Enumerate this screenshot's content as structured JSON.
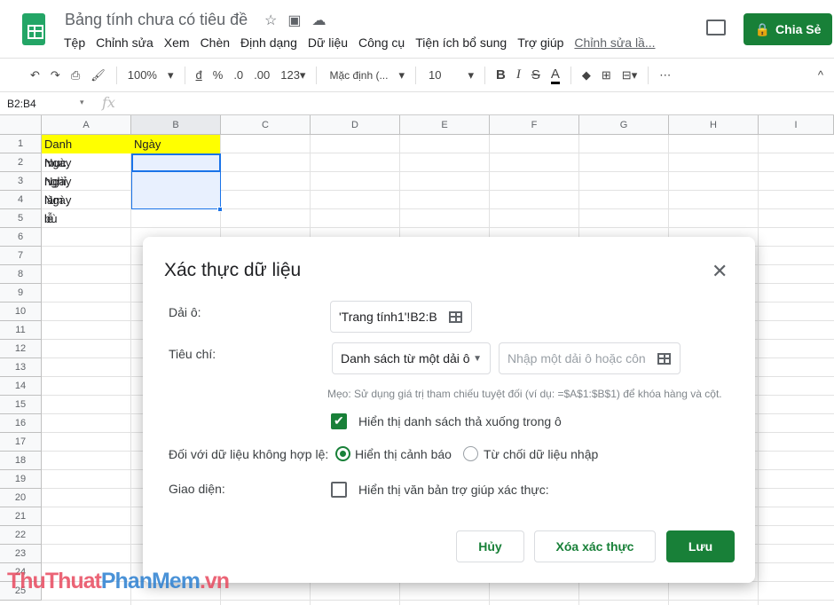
{
  "app": {
    "title": "Bảng tính chưa có tiêu đề",
    "share_label": "Chia Sẻ",
    "brand_color": "#188038",
    "menu": [
      "Tệp",
      "Chỉnh sửa",
      "Xem",
      "Chèn",
      "Định dạng",
      "Dữ liệu",
      "Công cụ",
      "Tiện ích bổ sung",
      "Trợ giúp"
    ],
    "last_edit": "Chỉnh sửa lầ..."
  },
  "toolbar": {
    "zoom": "100%",
    "currency": "đ",
    "percent": "%",
    "dec_less": ".0",
    "dec_more": ".00",
    "format": "123▾",
    "font": "Mặc định (...",
    "size": "10",
    "bold": "B",
    "italic": "I",
    "strike": "S",
    "text_color": "A"
  },
  "formula_bar": {
    "name_box": "B2:B4",
    "fx": "fx"
  },
  "sheet": {
    "columns": [
      "A",
      "B",
      "C",
      "D",
      "E",
      "F",
      "G",
      "H",
      "I"
    ],
    "rows": [
      "1",
      "2",
      "3",
      "4",
      "5",
      "6",
      "7",
      "8",
      "9",
      "10",
      "11",
      "12",
      "13",
      "14",
      "15",
      "16",
      "17",
      "18",
      "19",
      "20",
      "21",
      "22",
      "23",
      "24",
      "25"
    ],
    "cells": {
      "A1": "Danh mục",
      "B1": "Ngày",
      "A2": "Ngày nghỉ",
      "A3": "Ngày làm bù",
      "A4": "Ngày lễ"
    },
    "header_fill": "#ffff00"
  },
  "dialog": {
    "title": "Xác thực dữ liệu",
    "range_label": "Dải ô:",
    "range_value": "'Trang tính1'!B2:B",
    "criteria_label": "Tiêu chí:",
    "criteria_value": "Danh sách từ một dải ô",
    "criteria_placeholder": "Nhập một dải ô hoặc côn",
    "tip": "Mẹo: Sử dụng giá trị tham chiếu tuyệt đối (ví dụ: =$A$1:$B$1) để khóa hàng và cột.",
    "show_dropdown": "Hiển thị danh sách thả xuống trong ô",
    "show_dropdown_checked": true,
    "invalid_label": "Đối với dữ liệu không hợp lệ:",
    "invalid_options": [
      "Hiển thị cảnh báo",
      "Từ chối dữ liệu nhập"
    ],
    "invalid_selected": "Hiển thị cảnh báo",
    "appearance_label": "Giao diện:",
    "help_text": "Hiển thị văn bản trợ giúp xác thực:",
    "help_text_checked": false,
    "cancel": "Hủy",
    "remove": "Xóa xác thực",
    "save": "Lưu"
  },
  "watermark": {
    "a": "ThuThuat",
    "b": "PhanMem",
    "c": ".vn"
  }
}
